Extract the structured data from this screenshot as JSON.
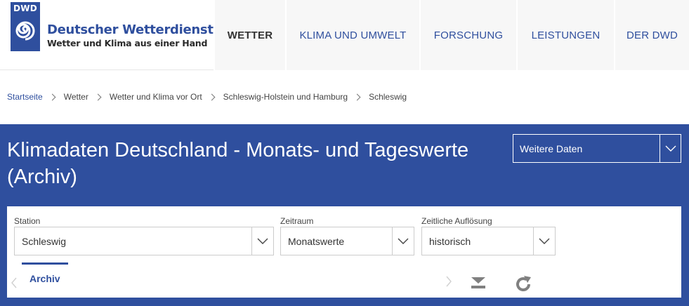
{
  "header": {
    "logo": {
      "abbr": "DWD",
      "title": "Deutscher Wetterdienst",
      "subtitle": "Wetter und Klima aus einer Hand"
    },
    "nav": [
      {
        "label": "WETTER",
        "active": true
      },
      {
        "label": "KLIMA UND UMWELT",
        "active": false
      },
      {
        "label": "FORSCHUNG",
        "active": false
      },
      {
        "label": "LEISTUNGEN",
        "active": false
      },
      {
        "label": "DER DWD",
        "active": false
      }
    ]
  },
  "breadcrumb": [
    "Startseite",
    "Wetter",
    "Wetter und Klima vor Ort",
    "Schleswig-Holstein und Hamburg",
    "Schleswig"
  ],
  "banner": {
    "title": "Klimadaten Deutschland - Monats- und Tageswerte (Archiv)",
    "more_data_label": "Weitere Daten"
  },
  "form": {
    "station": {
      "label": "Station",
      "value": "Schleswig"
    },
    "zeitraum": {
      "label": "Zeitraum",
      "value": "Monatswerte"
    },
    "aufloesung": {
      "label": "Zeitliche Auflösung",
      "value": "historisch"
    }
  },
  "tabs": [
    {
      "label": "Archiv",
      "active": true
    }
  ],
  "icons": {
    "download": "download-icon",
    "refresh": "refresh-icon",
    "chevron": "chevron-down-icon"
  },
  "colors": {
    "brand": "#2f4f9e",
    "nav_bg": "#f7f7f7",
    "icon_gray": "#808080"
  }
}
